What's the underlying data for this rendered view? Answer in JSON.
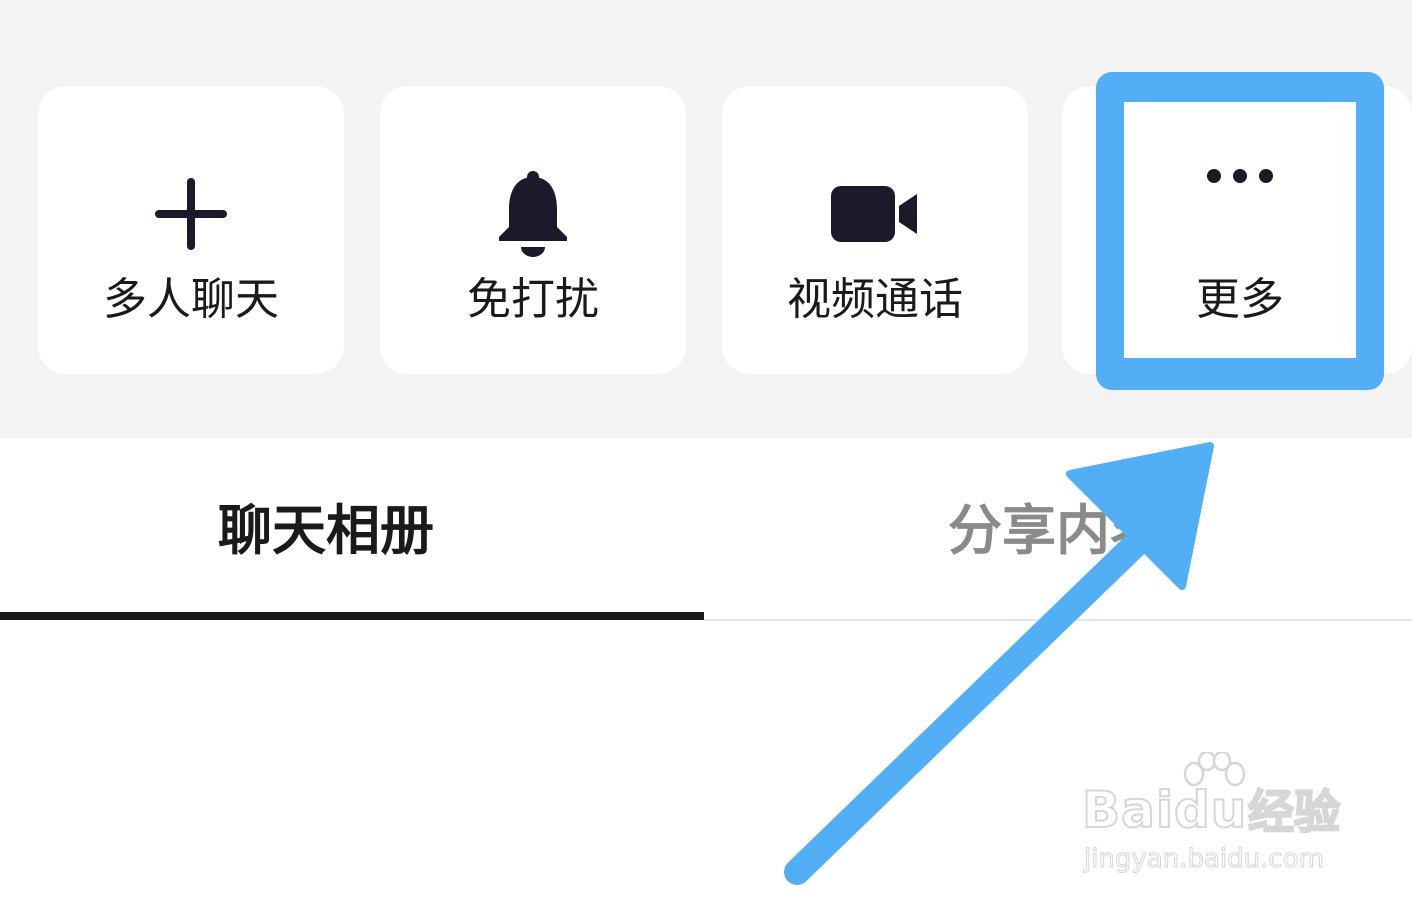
{
  "quick_actions": [
    {
      "label": "多人聊天",
      "icon": "plus-icon"
    },
    {
      "label": "免打扰",
      "icon": "bell-icon"
    },
    {
      "label": "视频通话",
      "icon": "video-camera-icon"
    },
    {
      "label": "更多",
      "icon": "more-dots-icon"
    }
  ],
  "tabs": {
    "active": "聊天相册",
    "inactive": "分享内容"
  },
  "annotation": {
    "highlight_color": "#52aef5",
    "arrow_color": "#52aef5"
  },
  "watermark": {
    "brand": "Bai",
    "brand_du": "du",
    "brand_cn": "经验",
    "url": "jingyan.baidu.com"
  }
}
